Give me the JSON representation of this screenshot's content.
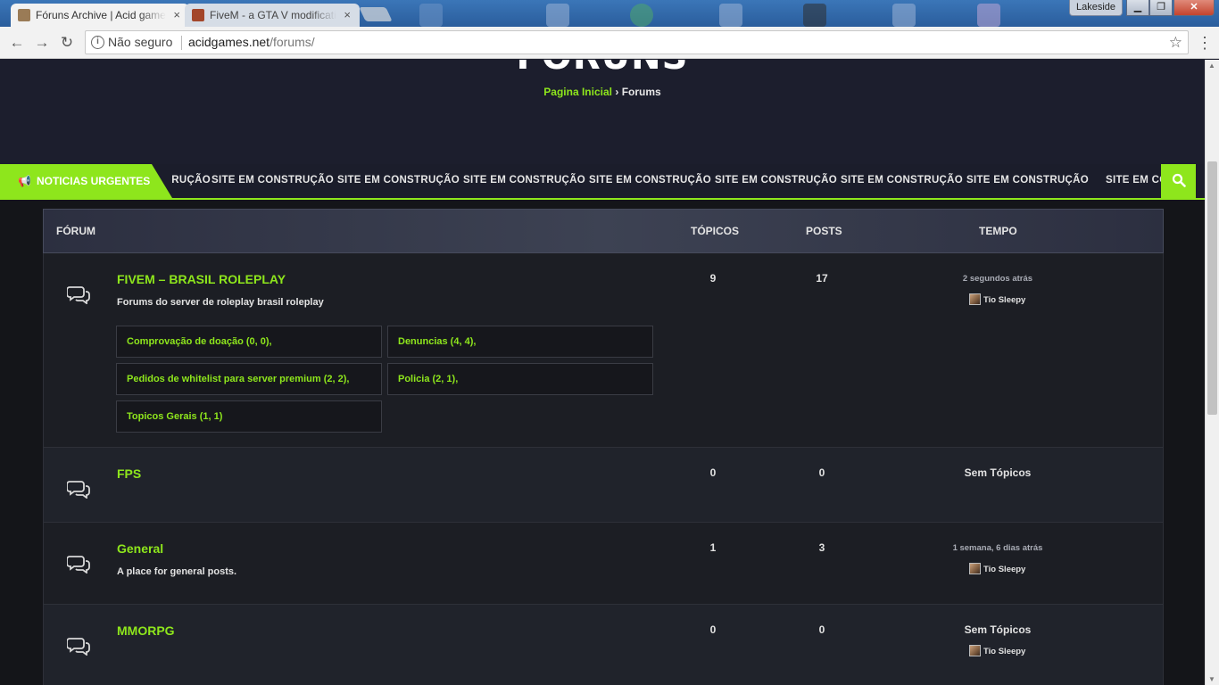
{
  "browser": {
    "tabs": [
      {
        "title": "Fóruns Archive | Acid games",
        "close": "×",
        "favicon_color": "#9a7b56"
      },
      {
        "title": "FiveM - a GTA V modification",
        "close": "×",
        "favicon_color": "#a3462a"
      }
    ],
    "user_profile": "Lakeside",
    "window_buttons": {
      "minimize": "▁",
      "maximize": "❐",
      "close": "✕"
    },
    "nav": {
      "back": "←",
      "forward": "→",
      "reload": "↻"
    },
    "address": {
      "security_icon": "i",
      "security_text": "Não seguro",
      "domain": "acidgames.net",
      "path": "/forums/"
    },
    "bookmark_icon": "☆",
    "menu_icon": "⋮"
  },
  "hero": {
    "title": "FÓRUNS",
    "breadcrumb": {
      "home": "Pagina Inicial",
      "separator": "›",
      "current": "Forums"
    }
  },
  "ticker": {
    "badge_icon": "📢",
    "badge_label": "NOTICIAS URGENTES",
    "items": [
      "STRUÇÃO",
      "SITE EM CONSTRUÇÃO",
      "SITE EM CONSTRUÇÃO",
      "SITE EM CONSTRUÇÃO",
      "SITE EM CONSTRUÇÃO",
      "SITE EM CONSTRUÇÃO",
      "SITE EM CONSTRUÇÃO",
      "SITE EM CONSTRUÇÃO",
      "SITE EM CONSTRUÇÃO"
    ],
    "search_icon": "🔍"
  },
  "table": {
    "headers": {
      "forum": "FÓRUM",
      "topics": "TÓPICOS",
      "posts": "POSTS",
      "time": "TEMPO"
    },
    "rows": [
      {
        "name": "FIVEM – BRASIL ROLEPLAY",
        "description": "Forums do server de roleplay brasil roleplay",
        "topics": "9",
        "posts": "17",
        "time": "2 segundos atrás",
        "user": "Tio Sleepy",
        "subforums": [
          "Comprovação de doação (0, 0),",
          "Denuncias (4, 4),",
          "Pedidos de whitelist para server premium (2, 2),",
          "Policia (2, 1),",
          "Topicos Gerais (1, 1)"
        ]
      },
      {
        "name": "FPS",
        "description": "",
        "topics": "0",
        "posts": "0",
        "time": "Sem Tópicos",
        "user": ""
      },
      {
        "name": "General",
        "description": "A place for general posts.",
        "topics": "1",
        "posts": "3",
        "time": "1 semana, 6 dias atrás",
        "user": "Tio Sleepy"
      },
      {
        "name": "MMORPG",
        "description": "",
        "topics": "0",
        "posts": "0",
        "time": "Sem Tópicos",
        "user": "Tio Sleepy"
      }
    ]
  },
  "colors": {
    "accent": "#8ee61c",
    "page_bg": "#141519",
    "hero_bg": "#1c1e2d"
  }
}
